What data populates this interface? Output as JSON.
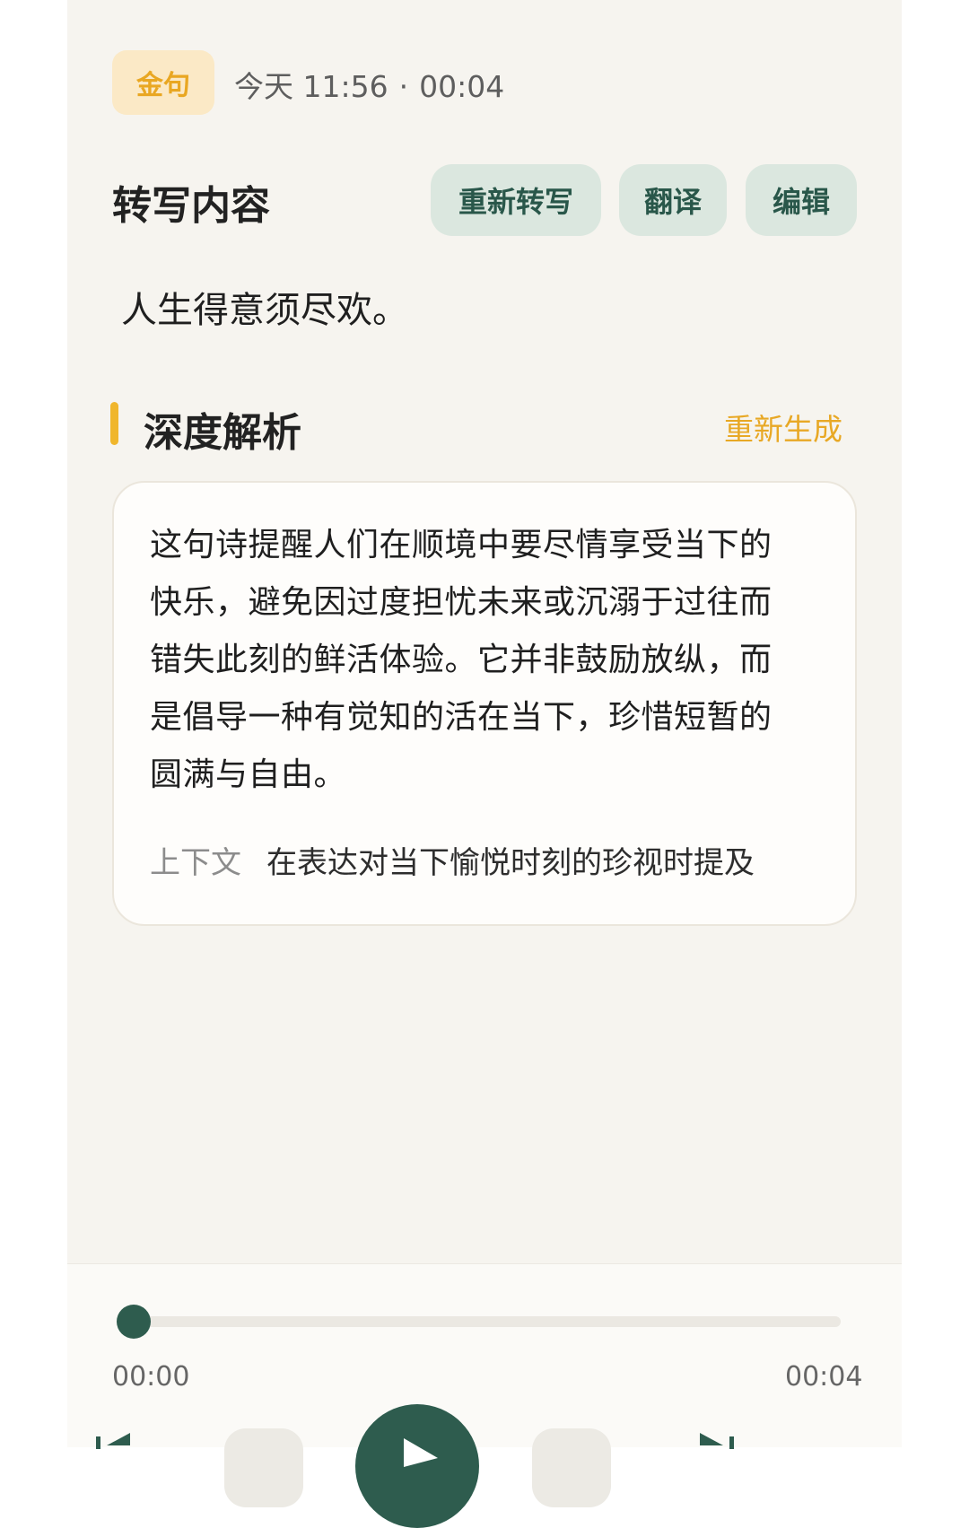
{
  "header": {
    "tag_label": "金句",
    "date": "今天 11:56",
    "separator": "·",
    "duration": "00:04"
  },
  "transcript_section": {
    "title": "转写内容",
    "buttons": {
      "retranscribe": "重新转写",
      "translate": "翻译",
      "edit": "编辑"
    },
    "text": "人生得意须尽欢。"
  },
  "analysis_section": {
    "title": "深度解析",
    "regenerate_label": "重新生成",
    "body": "这句诗提醒人们在顺境中要尽情享受当下的快乐，避免因过度担忧未来或沉溺于过往而错失此刻的鲜活体验。它并非鼓励放纵，而是倡导一种有觉知的活在当下，珍惜短暂的圆满与自由。",
    "context_label": "上下文",
    "context_text": "在表达对当下愉悦时刻的珍视时提及"
  },
  "player": {
    "current_time": "00:00",
    "total_time": "00:04",
    "progress_fraction": 0.0
  },
  "colors": {
    "accent_green": "#2e5c4e",
    "accent_yellow": "#f0b62c",
    "tag_bg": "#fbe9c6",
    "pill_bg": "#dbe7df",
    "page_bg": "#f6f4ef"
  }
}
